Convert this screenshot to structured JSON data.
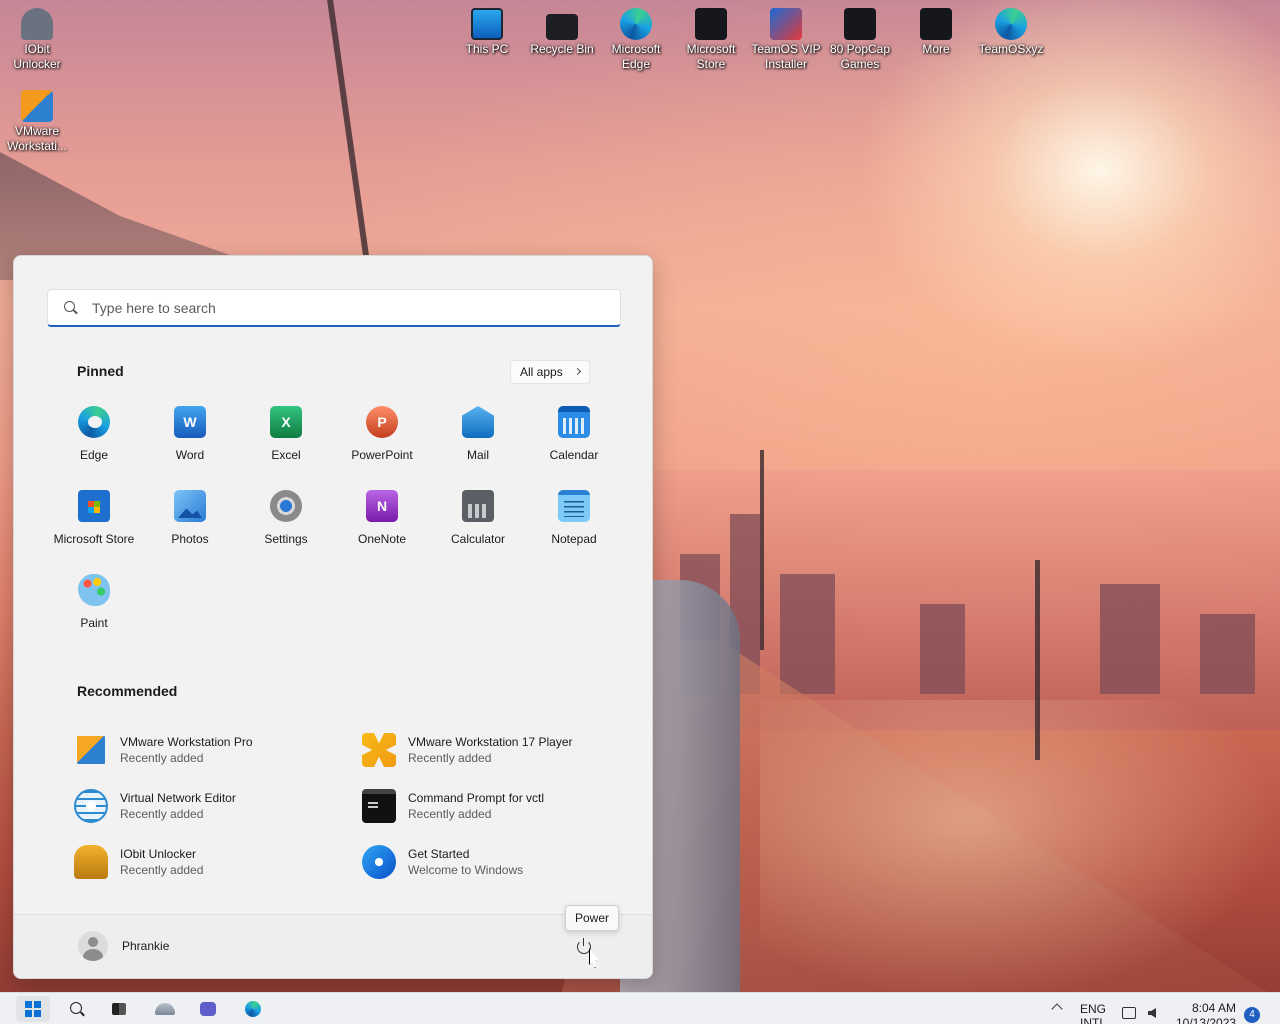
{
  "desktop": {
    "icons": [
      {
        "label": "IObit Unlocker",
        "icon": "iobit-unlocker-icon"
      },
      {
        "label": "VMware Workstati...",
        "icon": "vmware-icon"
      },
      {
        "label": "This PC",
        "icon": "this-pc-icon"
      },
      {
        "label": "Recycle Bin",
        "icon": "recycle-bin-icon"
      },
      {
        "label": "Microsoft Edge",
        "icon": "edge-icon"
      },
      {
        "label": "Microsoft Store",
        "icon": "store-icon"
      },
      {
        "label": "TeamOS VIP Installer",
        "icon": "teamos-installer-icon"
      },
      {
        "label": "80 PopCap Games",
        "icon": "popcap-games-icon"
      },
      {
        "label": "More",
        "icon": "more-icon"
      },
      {
        "label": "TeamOSxyz",
        "icon": "edge-icon"
      }
    ]
  },
  "start_menu": {
    "search": {
      "placeholder": "Type here to search"
    },
    "pinned": {
      "title": "Pinned",
      "all_apps_label": "All apps",
      "apps": [
        {
          "label": "Edge",
          "icon": "edge-icon"
        },
        {
          "label": "Word",
          "icon": "word-icon"
        },
        {
          "label": "Excel",
          "icon": "excel-icon"
        },
        {
          "label": "PowerPoint",
          "icon": "powerpoint-icon"
        },
        {
          "label": "Mail",
          "icon": "mail-icon"
        },
        {
          "label": "Calendar",
          "icon": "calendar-icon"
        },
        {
          "label": "Microsoft Store",
          "icon": "store-icon"
        },
        {
          "label": "Photos",
          "icon": "photos-icon"
        },
        {
          "label": "Settings",
          "icon": "gear-icon"
        },
        {
          "label": "OneNote",
          "icon": "onenote-icon"
        },
        {
          "label": "Calculator",
          "icon": "calculator-icon"
        },
        {
          "label": "Notepad",
          "icon": "notepad-icon"
        },
        {
          "label": "Paint",
          "icon": "paint-icon"
        }
      ]
    },
    "recommended": {
      "title": "Recommended",
      "items": [
        {
          "name": "VMware Workstation Pro",
          "sub": "Recently added",
          "icon": "vmware-workstation-icon"
        },
        {
          "name": "VMware Workstation 17 Player",
          "sub": "Recently added",
          "icon": "vmware-player-icon"
        },
        {
          "name": "Virtual Network Editor",
          "sub": "Recently added",
          "icon": "network-globe-icon"
        },
        {
          "name": "Command Prompt for vctl",
          "sub": "Recently added",
          "icon": "command-prompt-icon"
        },
        {
          "name": "IObit Unlocker",
          "sub": "Recently added",
          "icon": "iobit-unlocker-icon"
        },
        {
          "name": "Get Started",
          "sub": "Welcome to Windows",
          "icon": "get-started-icon"
        }
      ]
    },
    "footer": {
      "user_name": "Phrankie",
      "power_tooltip": "Power"
    }
  },
  "taskbar": {
    "language": "ENG",
    "language_sub": "INTL",
    "time": "8:04 AM",
    "date": "10/13/2023",
    "notification_count": "4"
  }
}
